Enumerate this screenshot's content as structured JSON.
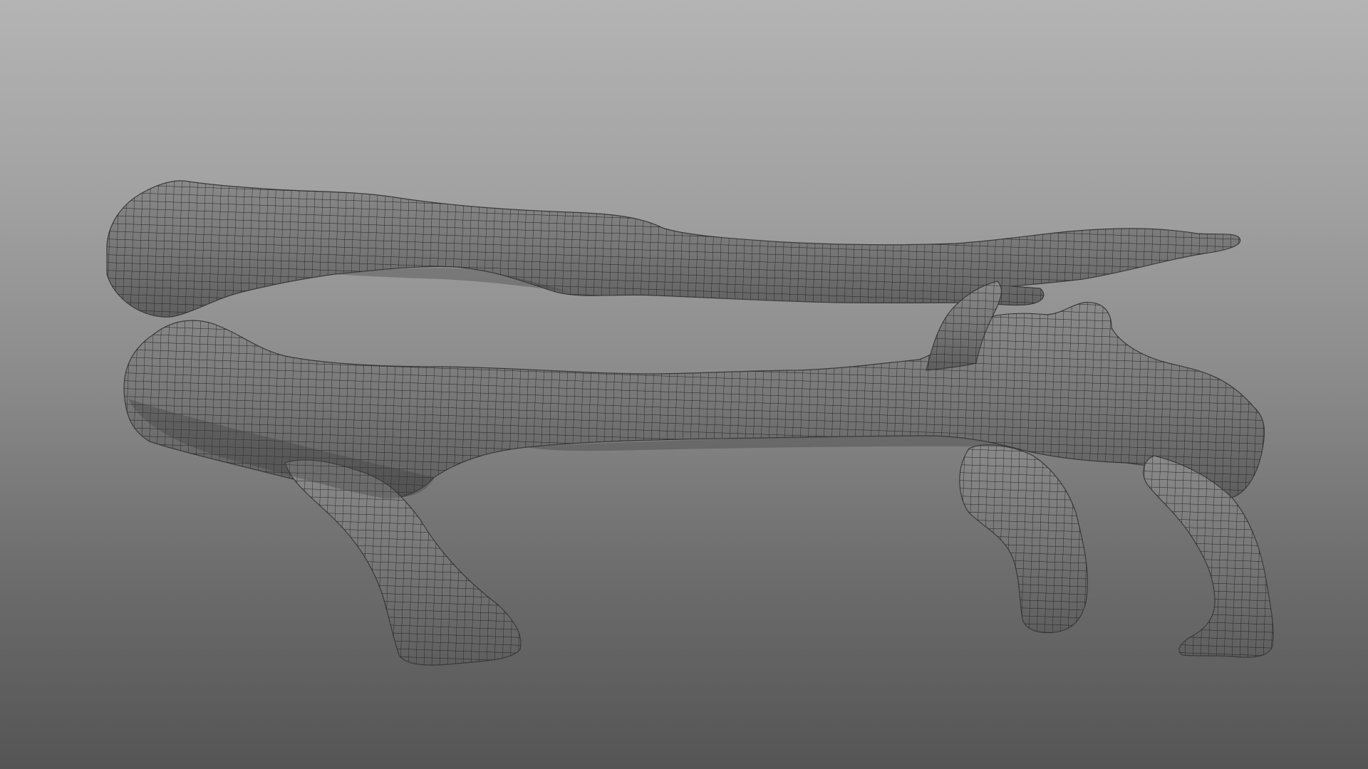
{
  "scene": {
    "subject": "branch-bench-wireframe-model",
    "colors": {
      "background_top": "#b4b4b4",
      "background_bottom": "#555555",
      "mesh_fill": "#747474",
      "mesh_shade": "#5c5c5c",
      "wire": "#202020"
    }
  }
}
